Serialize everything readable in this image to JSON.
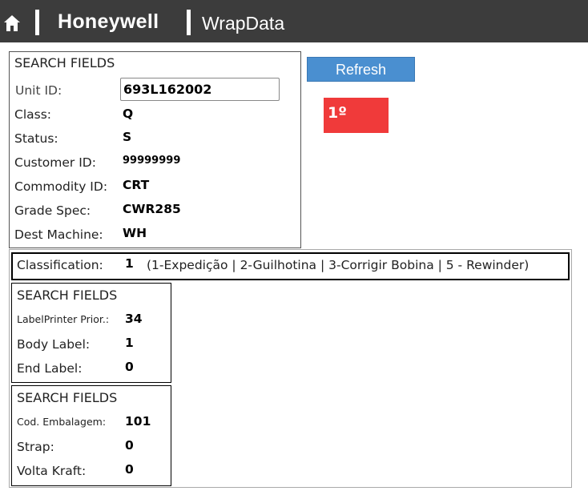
{
  "header": {
    "brand": "Honeywell",
    "app_name": "WrapData",
    "home_icon": "home-icon"
  },
  "search": {
    "title": "SEARCH FIELDS",
    "unit_id_label": "Unit ID:",
    "unit_id_value": "693L162002",
    "fields": [
      {
        "label": "Class:",
        "value": "Q"
      },
      {
        "label": "Status:",
        "value": "S"
      },
      {
        "label": "Customer ID:",
        "value": "99999999"
      },
      {
        "label": "Commodity ID:",
        "value": "CRT"
      },
      {
        "label": "Grade Spec:",
        "value": "CWR285"
      },
      {
        "label": "Dest Machine:",
        "value": "WH"
      }
    ]
  },
  "refresh_button": {
    "label": "Refresh",
    "color": "#4a8fd0"
  },
  "rank_badge": {
    "text": "1º",
    "color": "#f03a3a"
  },
  "classification": {
    "label": "Classification:",
    "value": "1",
    "options": "(1-Expedição | 2-Guilhotina | 3-Corrigir Bobina | 5 - Rewinder)"
  },
  "labels_box": {
    "title": "SEARCH FIELDS",
    "fields": [
      {
        "label": "LabelPrinter Prior.:",
        "value": "34"
      },
      {
        "label": "Body Label:",
        "value": "1"
      },
      {
        "label": "End Label:",
        "value": "0"
      }
    ]
  },
  "packaging_box": {
    "title": "SEARCH FIELDS",
    "fields": [
      {
        "label": "Cod. Embalagem:",
        "value": "101"
      },
      {
        "label": "Strap:",
        "value": "0"
      },
      {
        "label": "Volta Kraft:",
        "value": "0"
      }
    ]
  }
}
